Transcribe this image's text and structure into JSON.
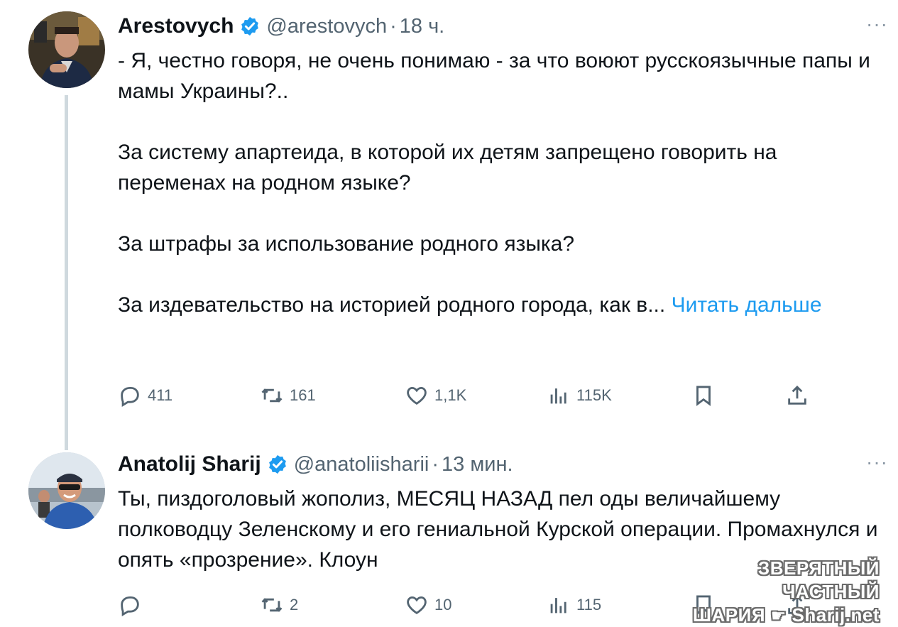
{
  "tweets": [
    {
      "name": "Arestovych",
      "handle": "@arestovych",
      "separator": "·",
      "time": "18 ч.",
      "more": "···",
      "paragraphs": [
        "- Я, честно говоря, не очень понимаю - за что воюют русскоязычные папы и мамы Украины?..",
        "За систему апартеида, в которой их детям запрещено говорить на переменах на родном языке?",
        "За штрафы за использование родного языка?",
        "За издевательство на историей родного города, как в..."
      ],
      "read_more": "Читать дальше",
      "stats": {
        "replies": "411",
        "retweets": "161",
        "likes": "1,1K",
        "views": "115K"
      }
    },
    {
      "name": "Anatolij Sharij",
      "handle": "@anatoliisharii",
      "separator": "·",
      "time": "13 мин.",
      "more": "···",
      "paragraphs": [
        "Ты, пиздоголовый жополиз, МЕСЯЦ НАЗАД пел оды величайшему полководцу Зеленскому и его гениальной Курской операции. Промахнулся и опять «прозрение». Клоун"
      ],
      "stats": {
        "replies": "",
        "retweets": "2",
        "likes": "10",
        "views": "115"
      }
    }
  ],
  "watermark": {
    "line1": "ЗВЕРЯТНЫЙ ЧАСТНЫЙ",
    "line2_prefix": "ШАРИЯ",
    "hand_icon": "pointing-hand-icon",
    "line2_suffix": "Sharij.net"
  },
  "colors": {
    "link": "#1d9bf0",
    "verified": "#1d9bf0",
    "secondary_text": "#536471",
    "thread_line": "#cfd9de"
  }
}
